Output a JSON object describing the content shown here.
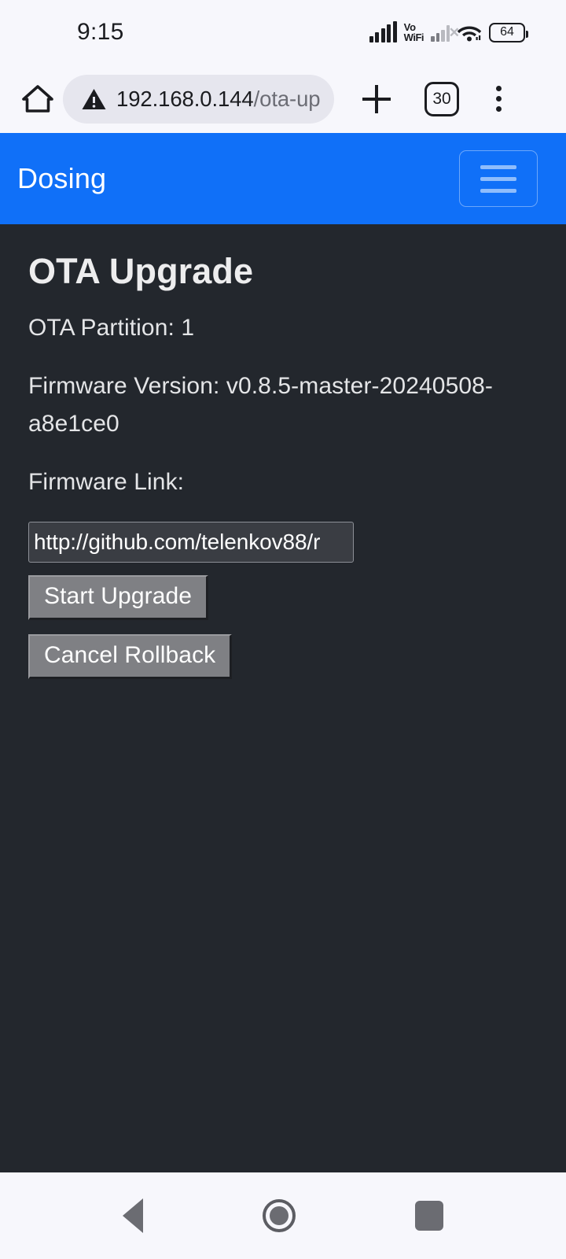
{
  "status_bar": {
    "clock": "9:15",
    "volte_line1": "Vo",
    "volte_line2": "WiFi",
    "battery_level": "64",
    "icons": [
      "signal-bars-icon",
      "volte-wifi-icon",
      "signal-bars-sim2-icon",
      "wifi-icon",
      "battery-icon"
    ]
  },
  "browser": {
    "home_icon": "home-icon",
    "security_icon": "warning-triangle-icon",
    "url_host": "192.168.0.144",
    "url_path": "/ota-up",
    "new_tab_icon": "plus-icon",
    "tab_count": "30",
    "menu_icon": "kebab-menu-icon"
  },
  "app_header": {
    "title": "Dosing",
    "menu_toggle_icon": "hamburger-menu-icon",
    "background_color": "#1070f8"
  },
  "content": {
    "heading": "OTA Upgrade",
    "partition_line": "OTA Partition: 1",
    "firmware_version_line": "Firmware Version: v0.8.5-master-20240508-a8e1ce0",
    "firmware_link_label": "Firmware Link:",
    "firmware_link_value": "http://github.com/telenkov88/r",
    "start_upgrade_label": "Start Upgrade",
    "cancel_rollback_label": "Cancel Rollback",
    "background_color": "#23272d",
    "text_color": "#e4e5e7"
  },
  "nav_bar": {
    "back_icon": "triangle-back-icon",
    "home_icon": "circle-home-icon",
    "recent_icon": "square-recents-icon"
  }
}
